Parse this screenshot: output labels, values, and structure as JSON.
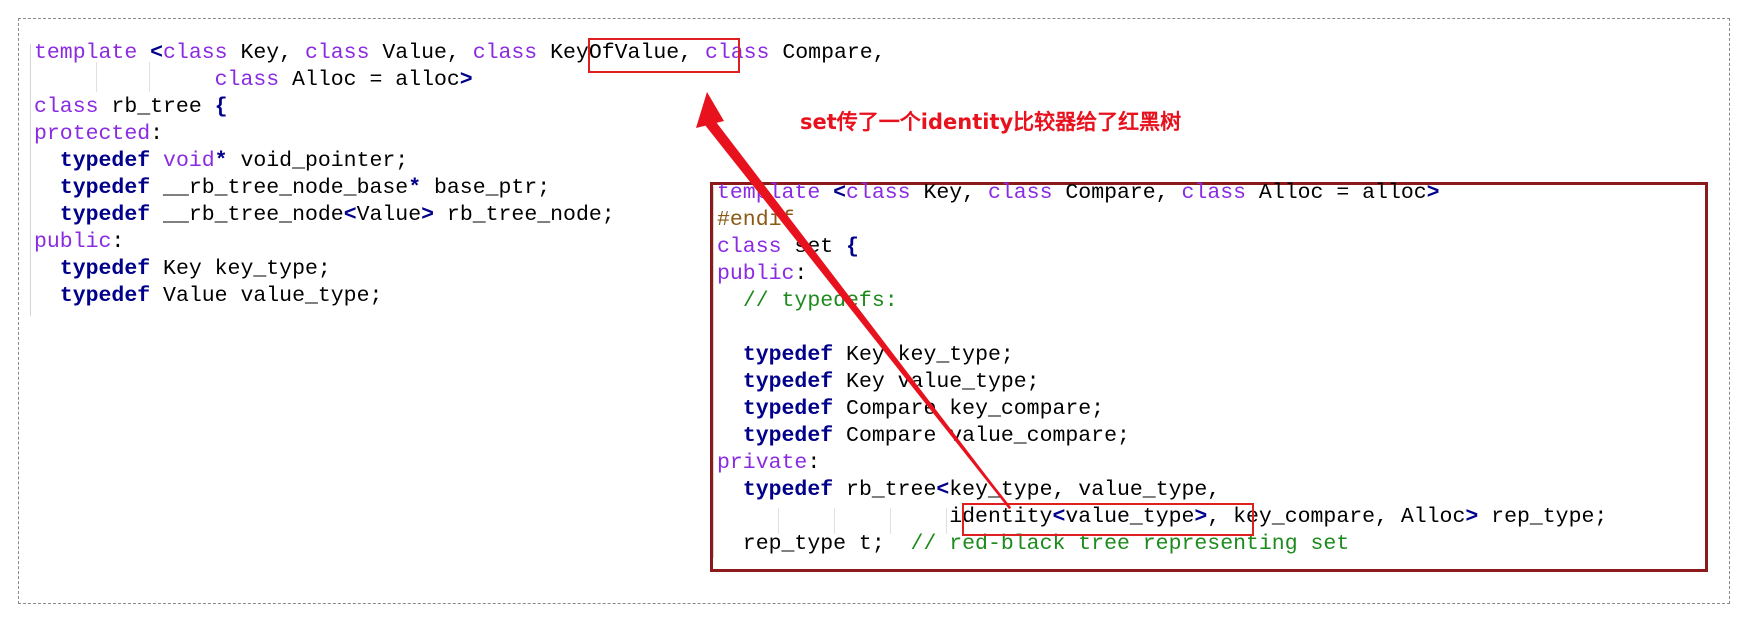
{
  "annotation": "set传了一个identity比较器给了红黑树",
  "left_code": [
    [
      [
        "kw",
        "template"
      ],
      [
        "t",
        " "
      ],
      [
        "tk",
        "<"
      ],
      [
        "kw",
        "class"
      ],
      [
        "t",
        " Key, "
      ],
      [
        "kw",
        "class"
      ],
      [
        "t",
        " Value, "
      ],
      [
        "kw",
        "class"
      ],
      [
        "t",
        " KeyOfValue, "
      ],
      [
        "kw",
        "class"
      ],
      [
        "t",
        " Compare,"
      ]
    ],
    [
      [
        "t",
        "              "
      ],
      [
        "kw",
        "class"
      ],
      [
        "t",
        " Alloc = alloc"
      ],
      [
        "tk",
        ">"
      ]
    ],
    [
      [
        "kw",
        "class"
      ],
      [
        "t",
        " rb_tree "
      ],
      [
        "tk",
        "{"
      ]
    ],
    [
      [
        "kw",
        "protected"
      ],
      [
        "t",
        ":"
      ]
    ],
    [
      [
        "t",
        "  "
      ],
      [
        "tk",
        "typedef"
      ],
      [
        "t",
        " "
      ],
      [
        "kw",
        "void"
      ],
      [
        "tk",
        "*"
      ],
      [
        "t",
        " void_pointer;"
      ]
    ],
    [
      [
        "t",
        "  "
      ],
      [
        "tk",
        "typedef"
      ],
      [
        "t",
        " __rb_tree_node_base"
      ],
      [
        "tk",
        "*"
      ],
      [
        "t",
        " base_ptr;"
      ]
    ],
    [
      [
        "t",
        "  "
      ],
      [
        "tk",
        "typedef"
      ],
      [
        "t",
        " __rb_tree_node"
      ],
      [
        "tk",
        "<"
      ],
      [
        "t",
        "Value"
      ],
      [
        "tk",
        ">"
      ],
      [
        "t",
        " rb_tree_node;"
      ]
    ],
    [
      [
        "kw",
        "public"
      ],
      [
        "t",
        ":"
      ]
    ],
    [
      [
        "t",
        "  "
      ],
      [
        "tk",
        "typedef"
      ],
      [
        "t",
        " Key key_type;"
      ]
    ],
    [
      [
        "t",
        "  "
      ],
      [
        "tk",
        "typedef"
      ],
      [
        "t",
        " Value value_type;"
      ]
    ]
  ],
  "right_code": [
    [
      [
        "kw",
        "template"
      ],
      [
        "t",
        " "
      ],
      [
        "tk",
        "<"
      ],
      [
        "kw",
        "class"
      ],
      [
        "t",
        " Key, "
      ],
      [
        "kw",
        "class"
      ],
      [
        "t",
        " Compare, "
      ],
      [
        "kw",
        "class"
      ],
      [
        "t",
        " Alloc = alloc"
      ],
      [
        "tk",
        ">"
      ]
    ],
    [
      [
        "pp",
        "#endif"
      ]
    ],
    [
      [
        "kw",
        "class"
      ],
      [
        "t",
        " set "
      ],
      [
        "tk",
        "{"
      ]
    ],
    [
      [
        "kw",
        "public"
      ],
      [
        "t",
        ":"
      ]
    ],
    [
      [
        "t",
        "  "
      ],
      [
        "cm",
        "// typedefs:"
      ]
    ],
    [
      [
        "t",
        ""
      ]
    ],
    [
      [
        "t",
        "  "
      ],
      [
        "tk",
        "typedef"
      ],
      [
        "t",
        " Key key_type;"
      ]
    ],
    [
      [
        "t",
        "  "
      ],
      [
        "tk",
        "typedef"
      ],
      [
        "t",
        " Key value_type;"
      ]
    ],
    [
      [
        "t",
        "  "
      ],
      [
        "tk",
        "typedef"
      ],
      [
        "t",
        " Compare key_compare;"
      ]
    ],
    [
      [
        "t",
        "  "
      ],
      [
        "tk",
        "typedef"
      ],
      [
        "t",
        " Compare value_compare;"
      ]
    ],
    [
      [
        "kw",
        "private"
      ],
      [
        "t",
        ":"
      ]
    ],
    [
      [
        "t",
        "  "
      ],
      [
        "tk",
        "typedef"
      ],
      [
        "t",
        " rb_tree"
      ],
      [
        "tk",
        "<"
      ],
      [
        "t",
        "key_type, value_type,"
      ]
    ],
    [
      [
        "t",
        "                  identity"
      ],
      [
        "tk",
        "<"
      ],
      [
        "t",
        "value_type"
      ],
      [
        "tk",
        ">"
      ],
      [
        "t",
        ", key_compare, Alloc"
      ],
      [
        "tk",
        ">"
      ],
      [
        "t",
        " rep_type;"
      ]
    ],
    [
      [
        "t",
        "  rep_type t;  "
      ],
      [
        "cm",
        "// red-black tree representing set"
      ]
    ]
  ]
}
